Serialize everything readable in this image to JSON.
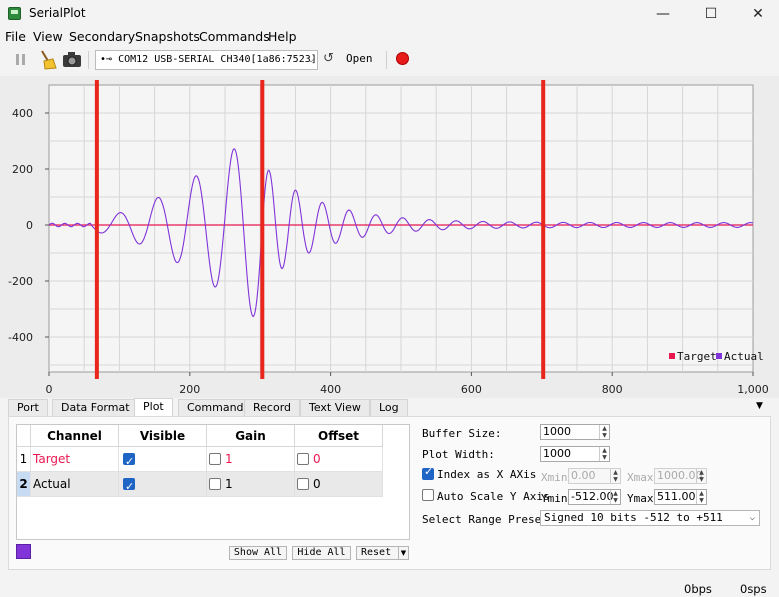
{
  "window": {
    "title": "SerialPlot",
    "min": "—",
    "max": "☐",
    "close": "✕"
  },
  "menu": [
    "File",
    "View",
    "Secondary",
    "Snapshots",
    "Commands",
    "Help"
  ],
  "toolbar": {
    "port": "COM12 USB-SERIAL CH340[1a86:7523]",
    "port_prefix": "•⊸",
    "refresh": "↺",
    "open_label": "Open"
  },
  "plot": {
    "x_ticks": [
      "0",
      "200",
      "400",
      "600",
      "800",
      "1,000"
    ],
    "y_ticks": [
      "400",
      "200",
      "0",
      "-200",
      "-400"
    ],
    "xlim": [
      0,
      1000
    ],
    "ylim": [
      -512,
      511
    ],
    "markers_x": [
      68,
      303,
      702
    ],
    "legend": [
      {
        "name": "Target",
        "color": "#e8174f"
      },
      {
        "name": "Actual",
        "color": "#8134d8"
      }
    ],
    "colors": {
      "marker": "#e8261c",
      "grid": "#d6d6d6",
      "bg": "#f5f5f5"
    }
  },
  "tabs": [
    "Port",
    "Data Format",
    "Plot",
    "Commands",
    "Record",
    "Text View",
    "Log"
  ],
  "active_tab": "Plot",
  "channels": {
    "headers": [
      "Channel",
      "Visible",
      "Gain",
      "Offset"
    ],
    "rows": [
      {
        "num": "1",
        "name": "Target",
        "visible": true,
        "gain": "1",
        "offset": "0",
        "color": "#e8174f"
      },
      {
        "num": "2",
        "name": "Actual",
        "visible": true,
        "gain": "1",
        "offset": "0",
        "color": "#000000"
      }
    ],
    "buttons": {
      "show_all": "Show All",
      "hide_all": "Hide All",
      "reset": "Reset"
    },
    "selected_color": "#8134d8"
  },
  "settings": {
    "buffer_size_label": "Buffer Size:",
    "buffer_size": "1000",
    "plot_width_label": "Plot Width:",
    "plot_width": "1000",
    "index_x_label": "Index as X AXis",
    "index_x": true,
    "xmin_label": "Xmin",
    "xmin": "0.00",
    "xmax_label": "Xmax",
    "xmax": "1000.00",
    "autoscale_label": "Auto Scale Y Axis",
    "autoscale": false,
    "ymin_label": "Ymin",
    "ymin": "-512.00",
    "ymax_label": "Ymax",
    "ymax": "511.00",
    "preset_label": "Select Range Preset:",
    "preset": "Signed 10 bits -512 to +511"
  },
  "status": {
    "bps": "0bps",
    "sps": "0sps"
  }
}
